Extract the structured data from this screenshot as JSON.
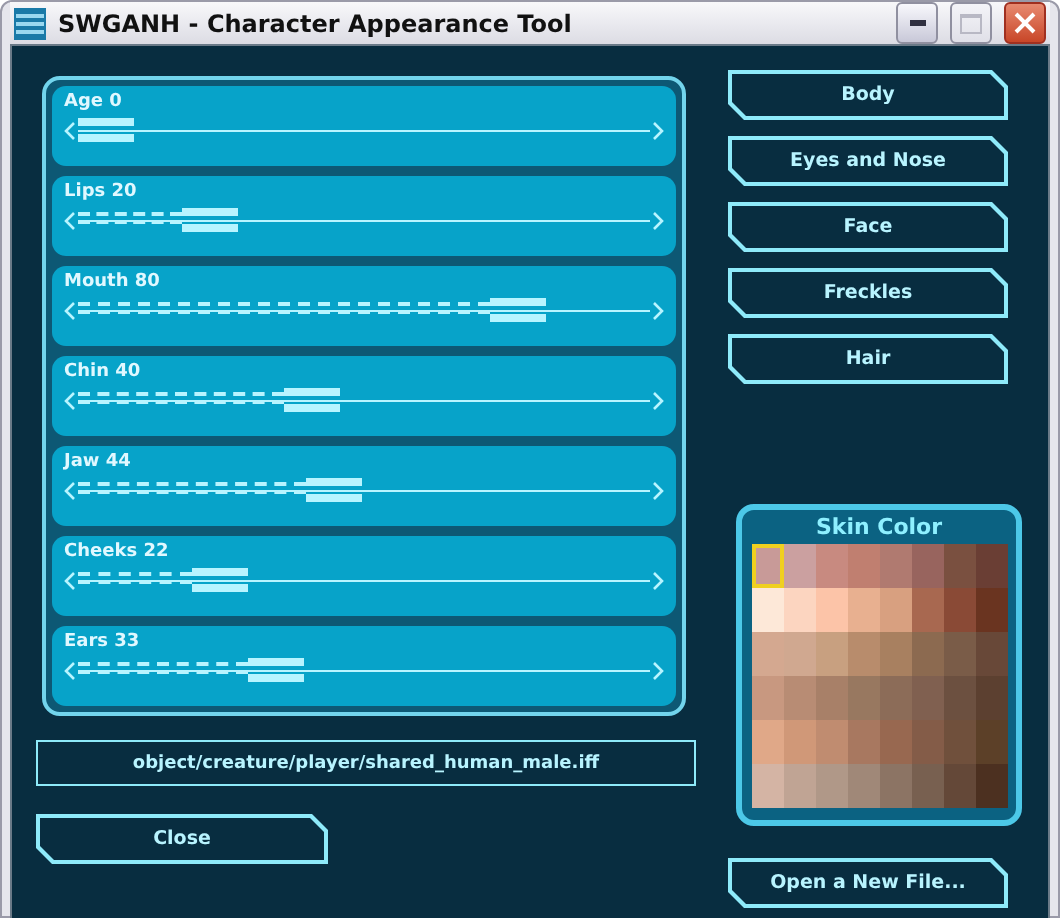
{
  "window": {
    "title": "SWGANH - Character Appearance Tool",
    "controls": {
      "minimize_disabled": false,
      "maximize_disabled": true
    }
  },
  "sliders": [
    {
      "label": "Age 0",
      "level": 0
    },
    {
      "label": "Lips 20",
      "level": 0.2
    },
    {
      "label": "Mouth 80",
      "level": 0.8
    },
    {
      "label": "Chin 40",
      "level": 0.4
    },
    {
      "label": "Jaw 44",
      "level": 0.44
    },
    {
      "label": "Cheeks 22",
      "level": 0.22
    },
    {
      "label": "Ears 33",
      "level": 0.33
    }
  ],
  "section_buttons": [
    "Body",
    "Eyes and Nose",
    "Face",
    "Freckles",
    "Hair"
  ],
  "skin_color": {
    "title": "Skin Color",
    "swatches": [
      {
        "color": "#c89a98",
        "selected": true
      },
      {
        "color": "#cba0a0",
        "selected": false
      },
      {
        "color": "#c88a80",
        "selected": false
      },
      {
        "color": "#c07f70",
        "selected": false
      },
      {
        "color": "#b07a70",
        "selected": false
      },
      {
        "color": "#98645e",
        "selected": false
      },
      {
        "color": "#7a5040",
        "selected": false
      },
      {
        "color": "#6a3e34",
        "selected": false
      },
      {
        "color": "#fde8d8",
        "selected": false
      },
      {
        "color": "#fcd5c0",
        "selected": false
      },
      {
        "color": "#fcc4a8",
        "selected": false
      },
      {
        "color": "#e8b090",
        "selected": false
      },
      {
        "color": "#d8a080",
        "selected": false
      },
      {
        "color": "#a86850",
        "selected": false
      },
      {
        "color": "#8a4a36",
        "selected": false
      },
      {
        "color": "#6a3420",
        "selected": false
      },
      {
        "color": "#d4a890",
        "selected": false
      },
      {
        "color": "#d0a890",
        "selected": false
      },
      {
        "color": "#c8a080",
        "selected": false
      },
      {
        "color": "#b88c6c",
        "selected": false
      },
      {
        "color": "#a88060",
        "selected": false
      },
      {
        "color": "#8c6a50",
        "selected": false
      },
      {
        "color": "#7a5c48",
        "selected": false
      },
      {
        "color": "#684838",
        "selected": false
      },
      {
        "color": "#c89880",
        "selected": false
      },
      {
        "color": "#b88c74",
        "selected": false
      },
      {
        "color": "#a88068",
        "selected": false
      },
      {
        "color": "#987860",
        "selected": false
      },
      {
        "color": "#8c6c58",
        "selected": false
      },
      {
        "color": "#806050",
        "selected": false
      },
      {
        "color": "#6c5040",
        "selected": false
      },
      {
        "color": "#5c4030",
        "selected": false
      },
      {
        "color": "#e0a888",
        "selected": false
      },
      {
        "color": "#d09878",
        "selected": false
      },
      {
        "color": "#c08c70",
        "selected": false
      },
      {
        "color": "#a87860",
        "selected": false
      },
      {
        "color": "#986850",
        "selected": false
      },
      {
        "color": "#845c48",
        "selected": false
      },
      {
        "color": "#70503c",
        "selected": false
      },
      {
        "color": "#5c4028",
        "selected": false
      },
      {
        "color": "#d4b4a4",
        "selected": false
      },
      {
        "color": "#c0a494",
        "selected": false
      },
      {
        "color": "#b09888",
        "selected": false
      },
      {
        "color": "#a08878",
        "selected": false
      },
      {
        "color": "#8c7464",
        "selected": false
      },
      {
        "color": "#786050",
        "selected": false
      },
      {
        "color": "#644838",
        "selected": false
      },
      {
        "color": "#4c3020",
        "selected": false
      }
    ]
  },
  "file_path": "object/creature/player/shared_human_male.iff",
  "close_button": "Close",
  "open_button": "Open a New File..."
}
